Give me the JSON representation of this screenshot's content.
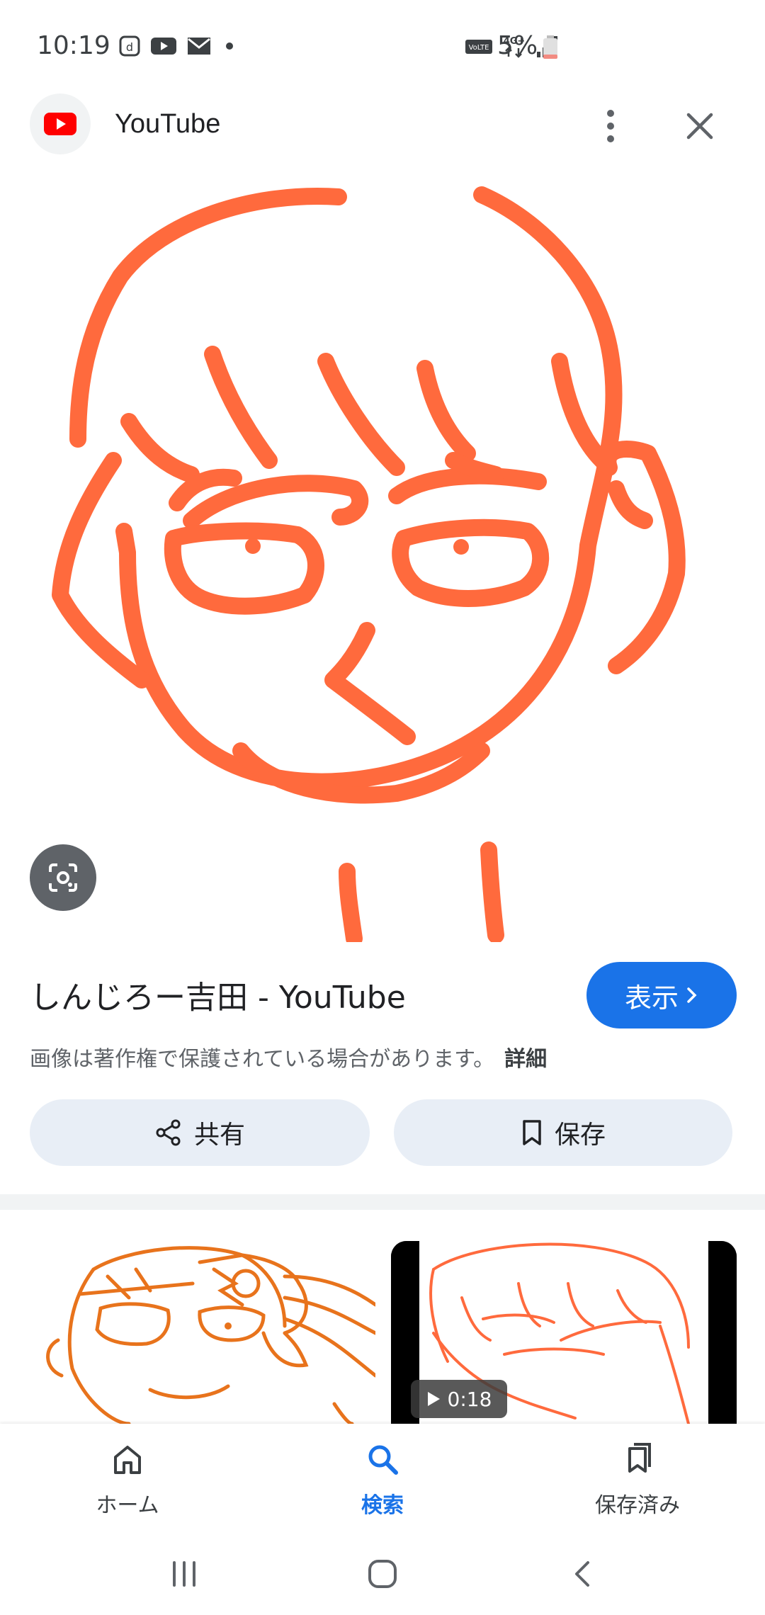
{
  "status_bar": {
    "time": "10:19",
    "battery_percent": "5%",
    "network": "4G+",
    "volte": "VoLTE"
  },
  "header": {
    "title": "YouTube"
  },
  "result": {
    "title": "しんじろー吉田 - YouTube",
    "visit_label": "表示",
    "copyright_notice": "画像は著作権で保護されている場合があります。",
    "details_link": "詳細",
    "share_label": "共有",
    "save_label": "保存"
  },
  "related": {
    "video_duration": "0:18"
  },
  "bottom_nav": {
    "items": [
      {
        "label": "ホーム",
        "icon": "home-icon"
      },
      {
        "label": "検索",
        "icon": "search-icon",
        "active": true
      },
      {
        "label": "保存済み",
        "icon": "saved-collections-icon"
      }
    ]
  },
  "colors": {
    "accent": "#1a73e8",
    "drawing_orange": "#ff6a3d",
    "youtube_red": "#ff0000"
  }
}
